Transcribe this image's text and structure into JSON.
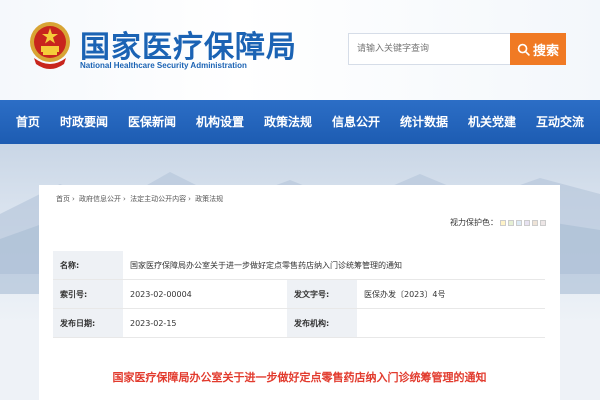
{
  "header": {
    "site_title": "国家医疗保障局",
    "site_subtitle": "National Healthcare Security Administration",
    "search_placeholder": "请输入关键字查询",
    "search_label": "搜索"
  },
  "nav": {
    "items": [
      "首页",
      "时政要闻",
      "医保新闻",
      "机构设置",
      "政策法规",
      "信息公开",
      "统计数据",
      "机关党建",
      "互动交流"
    ]
  },
  "breadcrumb": [
    "首页",
    "政府信息公开",
    "法定主动公开内容",
    "政策法规"
  ],
  "vision": {
    "label": "视力保护色：",
    "colors": [
      "#fff3c8",
      "#e6f0d4",
      "#dceaf5",
      "#e7e2f1",
      "#eee3d7",
      "#ede6e6"
    ]
  },
  "info": {
    "name_label": "名称:",
    "name_value": "国家医疗保障局办公室关于进一步做好定点零售药店纳入门诊统筹管理的通知",
    "index_label": "索引号:",
    "index_value": "2023-02-00004",
    "docnum_label": "发文字号:",
    "docnum_value": "医保办发〔2023〕4号",
    "date_label": "发布日期:",
    "date_value": "2023-02-15",
    "org_label": "发布机构:",
    "org_value": ""
  },
  "doc_title": "国家医疗保障局办公室关于进一步做好定点零售药店纳入门诊统筹管理的通知"
}
